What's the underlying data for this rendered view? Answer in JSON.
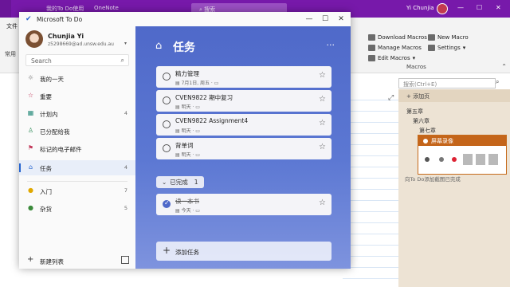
{
  "background_app": {
    "doc_title": "我的To Do使用",
    "app_name": "OneNote",
    "search_placeholder": "搜索",
    "user_name": "Yi Chunjia",
    "file_tab": "文件",
    "ribbon": {
      "download_macros": "Download Macros",
      "manage_macros": "Manage Macros",
      "edit_macros": "Edit Macros",
      "new_macro": "New Macro",
      "settings": "Settings",
      "group_label": "Macros"
    },
    "left_strip_top": "常用",
    "page_search_placeholder": "搜索(Ctrl+E)",
    "add_page": "+ 添加页",
    "pages": [
      "第五章",
      "第六章",
      "第七章"
    ],
    "recorder_title": "屏幕录像",
    "recorder_footer": "向To Do添加截图已完成"
  },
  "todo": {
    "window_title": "Microsoft To Do",
    "profile": {
      "name": "Chunjia Yi",
      "email": "z5298669@ad.unsw.edu.au"
    },
    "search_placeholder": "Search",
    "nav": [
      {
        "icon": "sun-icon",
        "glyph": "☼",
        "label": "我的一天",
        "count": ""
      },
      {
        "icon": "star-icon",
        "glyph": "☆",
        "label": "重要",
        "count": ""
      },
      {
        "icon": "calendar-icon",
        "glyph": "▦",
        "label": "计划内",
        "count": "4"
      },
      {
        "icon": "person-icon",
        "glyph": "♙",
        "label": "已分配给我",
        "count": ""
      },
      {
        "icon": "flag-icon",
        "glyph": "⚑",
        "label": "标记的电子邮件",
        "count": ""
      },
      {
        "icon": "home-icon",
        "glyph": "⌂",
        "label": "任务",
        "count": "4"
      }
    ],
    "lists": [
      {
        "icon": "emoji-icon",
        "glyph": "●",
        "label": "入门",
        "count": "7"
      },
      {
        "icon": "emoji-icon",
        "glyph": "●",
        "label": "杂货",
        "count": "5"
      }
    ],
    "new_list_label": "新建列表",
    "main": {
      "title": "任务",
      "more": "···",
      "tasks": [
        {
          "title": "精力管理",
          "meta": "▤ 7月1日, 周五 · ▭"
        },
        {
          "title": "CVEN9822 期中复习",
          "meta": "▤ 明天 · ▭"
        },
        {
          "title": "CVEN9822 Assignment4",
          "meta": "▤ 明天 · ▭"
        },
        {
          "title": "背单词",
          "meta": "▤ 明天 · ▭"
        }
      ],
      "completed_label": "已完成",
      "completed_count": "1",
      "completed_tasks": [
        {
          "title": "读一本书",
          "meta": "▤ 今天 · ▭"
        }
      ],
      "add_task_label": "添加任务"
    }
  },
  "colors": {
    "onenote_purple": "#7719aa",
    "todo_blue": "#4f69c9",
    "accent": "#2564cf"
  }
}
